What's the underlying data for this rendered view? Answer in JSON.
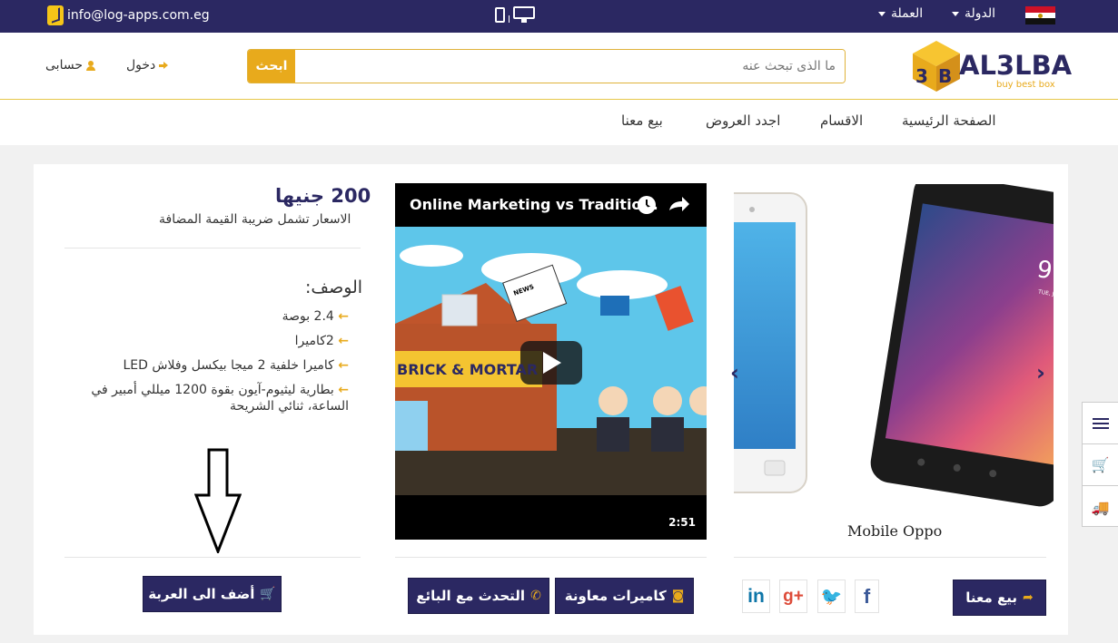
{
  "topbar": {
    "email": "info@log-apps.com.eg",
    "country_label": "الدولة",
    "currency_label": "العملة"
  },
  "header": {
    "search_placeholder": "ما الذى تبحث عنه",
    "search_button": "ابحث",
    "login_label": "دخول",
    "account_label": "حسابى",
    "logo_text": "AL3LBA",
    "logo_tagline": "buy best box"
  },
  "nav": {
    "items": [
      {
        "label": "الصفحة الرئيسية"
      },
      {
        "label": "الاقسام"
      },
      {
        "label": "اجدد العروض"
      },
      {
        "label": "بيع معنا"
      }
    ]
  },
  "product": {
    "name": "Mobile Oppo",
    "price": "200 جنيها",
    "vat_note": "الاسعار تشمل ضريبة القيمة المضافة",
    "description_title": "الوصف:",
    "features": [
      "2.4 بوصة",
      "2كاميرا",
      "كاميرا خلفية 2 ميجا بيكسل وفلاش LED",
      "بطارية ليثيوم-آيون بقوة 1200 ميللي أمبير في الساعة، ثنائي الشريحة"
    ]
  },
  "video": {
    "title": "Online Marketing vs Traditio...",
    "duration": "2:51",
    "sign_text": "BRICK & MORTAR",
    "news_label": "NEWS"
  },
  "actions": {
    "sell_with_us": "بيع معنا",
    "cameras": "كاميرات معاونة",
    "chat_seller": "التحدث مع البائع",
    "add_to_cart": "أضف الى العربة"
  },
  "colors": {
    "primary": "#2b2862",
    "accent": "#e8aa1c"
  }
}
